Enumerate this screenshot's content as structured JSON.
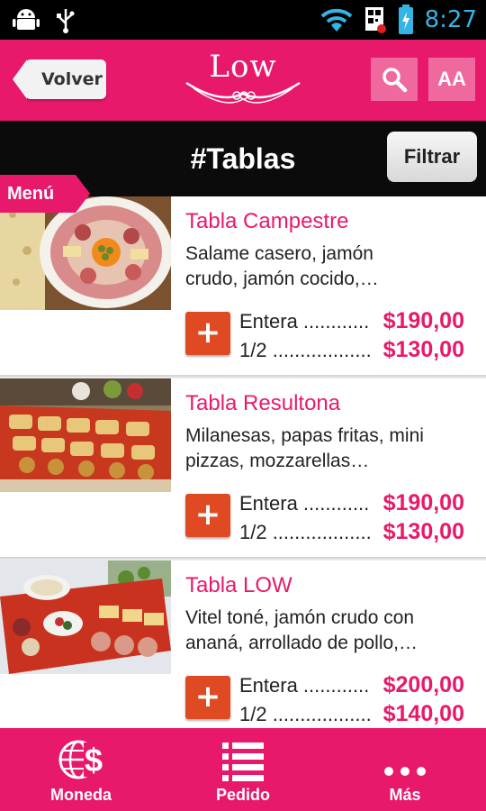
{
  "status_bar": {
    "time": "8:27"
  },
  "header": {
    "back_label": "Volver",
    "logo_text": "Low",
    "font_button_label": "AA"
  },
  "title_bar": {
    "title": "#Tablas",
    "filter_label": "Filtrar"
  },
  "menu_tag": {
    "label": "Menú"
  },
  "items": [
    {
      "name": "Tabla Campestre",
      "desc_line1": "Salame casero, jamón",
      "desc_line2": "crudo, jamón cocido,…",
      "add_label": "+",
      "rows": [
        {
          "label": "Entera ............",
          "price": "$190,00"
        },
        {
          "label": "1/2 ..................",
          "price": "$130,00"
        }
      ]
    },
    {
      "name": "Tabla Resultona",
      "desc_line1": "Milanesas, papas fritas, mini",
      "desc_line2": "pizzas, mozzarellas…",
      "add_label": "+",
      "rows": [
        {
          "label": "Entera ............",
          "price": "$190,00"
        },
        {
          "label": "1/2 ..................",
          "price": "$130,00"
        }
      ]
    },
    {
      "name": "Tabla LOW",
      "desc_line1": "Vitel toné, jamón crudo con",
      "desc_line2": "ananá, arrollado de pollo,…",
      "add_label": "+",
      "rows": [
        {
          "label": "Entera ............",
          "price": "$200,00"
        },
        {
          "label": "1/2 ..................",
          "price": "$140,00"
        }
      ]
    }
  ],
  "bottom_nav": [
    {
      "label": "Moneda",
      "icon": "currency-globe-icon"
    },
    {
      "label": "Pedido",
      "icon": "list-icon"
    },
    {
      "label": "Más",
      "icon": "more-dots-icon"
    }
  ],
  "colors": {
    "brand": "#e8196b",
    "add_button": "#e04a22",
    "title_bar": "#0b0b0b"
  }
}
